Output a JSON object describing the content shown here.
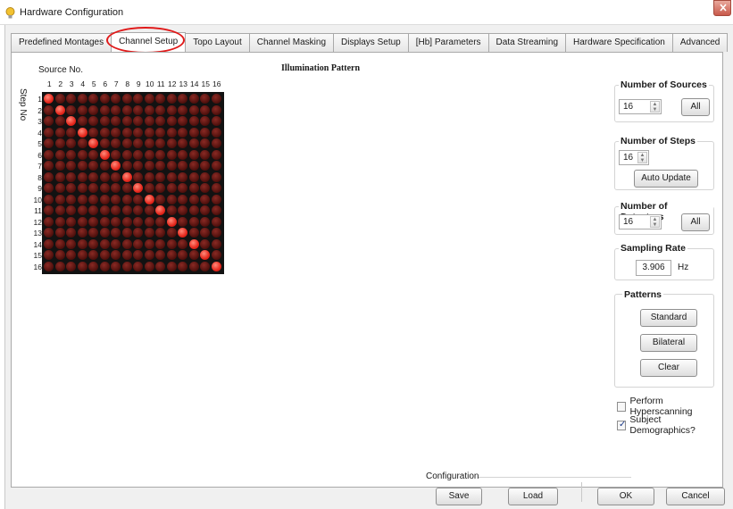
{
  "window": {
    "title": "Hardware Configuration",
    "icon": "bulb-icon"
  },
  "tabs": [
    {
      "label": "Predefined Montages"
    },
    {
      "label": "Channel Setup",
      "active": true
    },
    {
      "label": "Topo Layout"
    },
    {
      "label": "Channel Masking"
    },
    {
      "label": "Displays Setup"
    },
    {
      "label": "[Hb] Parameters"
    },
    {
      "label": "Data Streaming"
    },
    {
      "label": "Hardware Specification"
    },
    {
      "label": "Advanced"
    }
  ],
  "matrix": {
    "source_label": "Source No.",
    "step_label": "Step No",
    "columns": [
      "1",
      "2",
      "3",
      "4",
      "5",
      "6",
      "7",
      "8",
      "9",
      "10",
      "11",
      "12",
      "13",
      "14",
      "15",
      "16"
    ],
    "rows": [
      "1",
      "2",
      "3",
      "4",
      "5",
      "6",
      "7",
      "8",
      "9",
      "10",
      "11",
      "12",
      "13",
      "14",
      "15",
      "16"
    ],
    "active_cells": [
      [
        1,
        1
      ],
      [
        2,
        2
      ],
      [
        3,
        3
      ],
      [
        4,
        4
      ],
      [
        5,
        5
      ],
      [
        6,
        6
      ],
      [
        7,
        7
      ],
      [
        8,
        8
      ],
      [
        9,
        9
      ],
      [
        10,
        10
      ],
      [
        11,
        11
      ],
      [
        12,
        12
      ],
      [
        13,
        13
      ],
      [
        14,
        14
      ],
      [
        15,
        15
      ],
      [
        16,
        16
      ]
    ],
    "led_on_color": "#e5271c",
    "led_off_color": "#5a1410"
  },
  "illumination": {
    "title": "Illumination Pattern"
  },
  "number_of_sources": {
    "title": "Number of Sources",
    "value": "16",
    "all_label": "All"
  },
  "number_of_steps": {
    "title": "Number of Steps",
    "value": "16",
    "auto_update_label": "Auto Update"
  },
  "number_of_detectors": {
    "title": "Number of Detectors",
    "value": "16",
    "all_label": "All"
  },
  "sampling_rate": {
    "title": "Sampling Rate",
    "value": "3.906",
    "unit": "Hz"
  },
  "patterns": {
    "title": "Patterns",
    "standard_label": "Standard",
    "bilateral_label": "Bilateral",
    "clear_label": "Clear"
  },
  "options": {
    "hyperscanning_label": "Perform Hyperscanning",
    "hyperscanning_checked": false,
    "demographics_label": "Subject Demographics?",
    "demographics_checked": true
  },
  "configuration": {
    "title": "Configuration",
    "save_label": "Save",
    "load_label": "Load"
  },
  "dialog": {
    "ok_label": "OK",
    "cancel_label": "Cancel"
  },
  "colors": {
    "highlight_ring": "#e01a1a",
    "window_bg": "#f0f0f0"
  }
}
